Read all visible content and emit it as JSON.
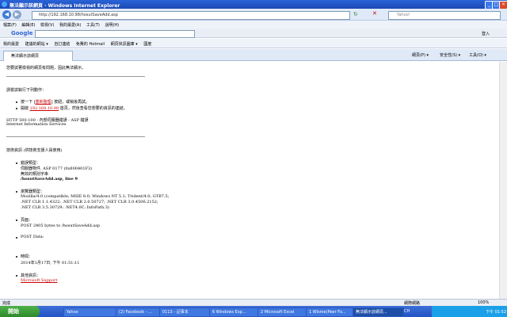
{
  "window": {
    "title": "無法顯示該網頁 - Windows Internet Explorer"
  },
  "address": {
    "url": "http://192.168.10.98/hosutSaveAdd.asp",
    "search_placeholder": "Yahoo!"
  },
  "menu": [
    "檔案(F)",
    "編輯(E)",
    "檢視(V)",
    "我的最愛(A)",
    "工具(T)",
    "說明(H)"
  ],
  "google": {
    "label": "Google",
    "right_label": "登入"
  },
  "favorites": {
    "label": "我的最愛",
    "items": [
      "建議的網站 ▾",
      "自訂連結",
      "免費的 Hotmail",
      "網頁快訊圖庫 ▾",
      "國度"
    ]
  },
  "tab": {
    "label": "無法顯示該網頁"
  },
  "tab_tools": [
    "網頁(P) ▾",
    "安全性(S) ▾",
    "工具(O) ▾"
  ],
  "content": {
    "line1": "您要試著檢視的網頁有問題，因此無法顯示。",
    "try_heading": "請嘗試執行下列動作：",
    "try_items": [
      "按一下[重新整理]按鈕，或稍後再試。",
      "開啟192.168.10.98首頁，然後查看您想要的資訊的連結。"
    ],
    "refresh_link": "重新整理",
    "home_link": "192.168.10.98",
    "error_line": "HTTP 500.100 - 內部伺服器錯誤 - ASP 錯誤",
    "server_line": "Internet Information Services",
    "tech_heading": "技術資訊 (供技術支援人員使用)",
    "err_type_label": "錯誤類型：",
    "err_type_lines": [
      "伺服器物件, ASP 0177 (0x800401F3)",
      "無效的類別字串"
    ],
    "err_file": "/hosutSaveAdd.asp, line 9",
    "browser_label": "瀏覽器類型：",
    "browser_lines": [
      "Mozilla/4.0 (compatible; MSIE 8.0; Windows NT 5.1; Trident/4.0; GTB7.5;",
      ".NET CLR 1.1.4322; .NET CLR 2.0.50727; .NET CLR 3.0.4506.2152;",
      ".NET CLR 3.5.30729; .NET4.0C; InfoPath.3)"
    ],
    "page_label": "頁面：",
    "page_value": "POST 2405 bytes to /hosutSaveAdd.asp",
    "post_label": "POST Data:",
    "time_label": "時間：",
    "time_value": "2014年1月17日, 下午 01:51:11",
    "more_label": "其他資訊：",
    "more_link": "Microsoft Support"
  },
  "status": {
    "left": "完成",
    "zone": "網際網路",
    "zoom": "100%"
  },
  "taskbar": {
    "start": "開始",
    "tasks": [
      "Yahoo",
      "(2) Facebook - ...",
      "0113 - 記事本",
      "6 Windows Exp...",
      "2 Microsoft Excel",
      "1 Wisme(Peer Fo...",
      "無法顯示該網頁..."
    ],
    "clock": "下午 01:52",
    "lang": "CH"
  }
}
